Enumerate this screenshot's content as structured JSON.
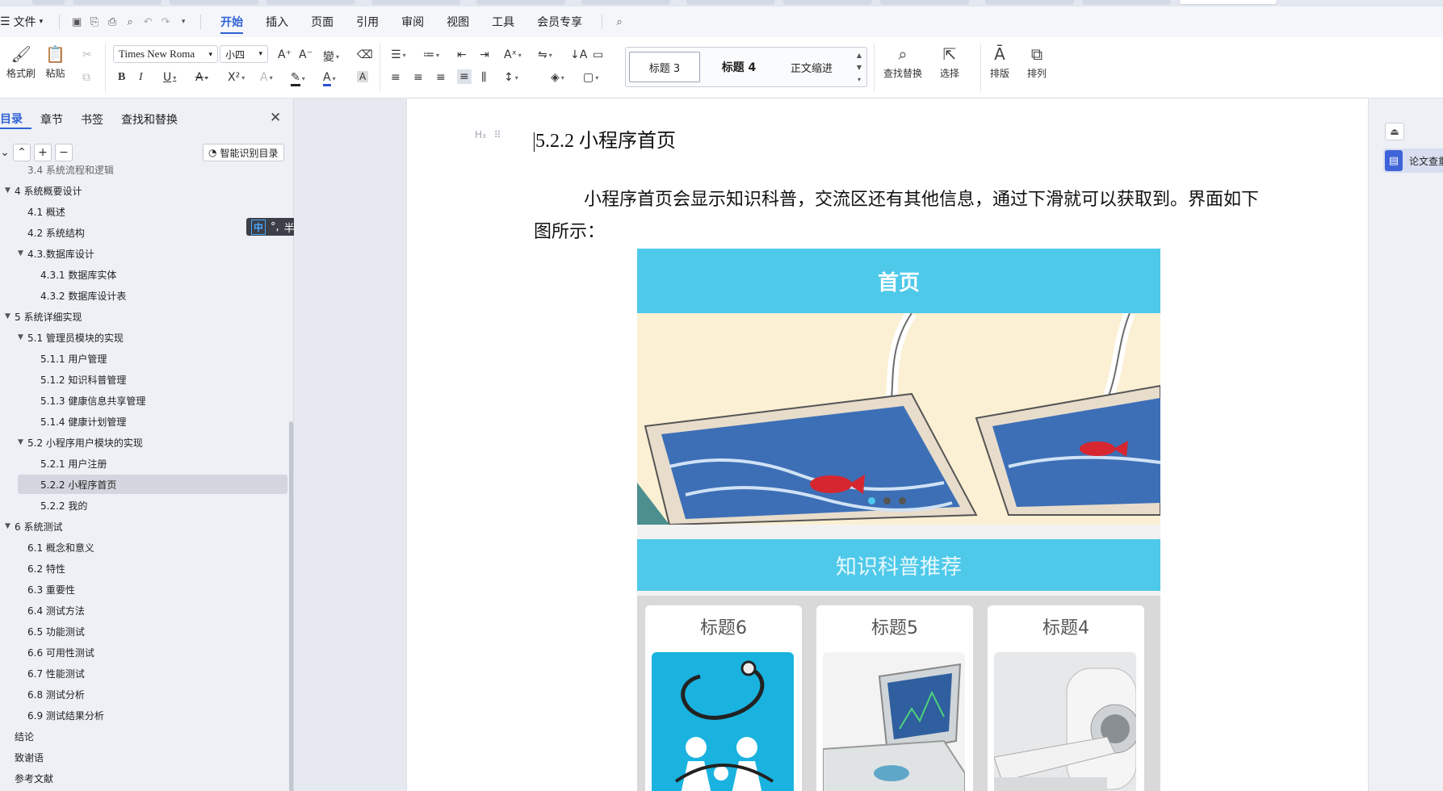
{
  "menubar": {
    "file": "文件",
    "tabs": [
      "开始",
      "插入",
      "页面",
      "引用",
      "审阅",
      "视图",
      "工具",
      "会员专享"
    ]
  },
  "ribbon": {
    "format_painter": "格式刷",
    "paste": "粘贴",
    "font_name": "Times New Roma",
    "font_size": "小四",
    "styles": [
      "标题 3",
      "标题 4",
      "正文缩进"
    ],
    "find_replace": "查找替换",
    "select": "选择",
    "layout": "排版",
    "arrange": "排列"
  },
  "navpanel": {
    "tabs": [
      "目录",
      "章节",
      "书签",
      "查找和替换"
    ],
    "smart_toc": "智能识别目录",
    "items": [
      {
        "label": "3.4 系统流程和逻辑",
        "level": 2,
        "expanded": null
      },
      {
        "label": "4 系统概要设计",
        "level": 1,
        "expanded": true
      },
      {
        "label": "4.1 概述",
        "level": 2,
        "expanded": null
      },
      {
        "label": "4.2 系统结构",
        "level": 2,
        "expanded": null
      },
      {
        "label": "4.3.数据库设计",
        "level": 2,
        "expanded": true
      },
      {
        "label": "4.3.1 数据库实体",
        "level": 3,
        "expanded": null
      },
      {
        "label": "4.3.2 数据库设计表",
        "level": 3,
        "expanded": null
      },
      {
        "label": "5 系统详细实现",
        "level": 1,
        "expanded": true
      },
      {
        "label": "5.1  管理员模块的实现",
        "level": 2,
        "expanded": true
      },
      {
        "label": "5.1.1  用户管理",
        "level": 3,
        "expanded": null
      },
      {
        "label": "5.1.2  知识科普管理",
        "level": 3,
        "expanded": null
      },
      {
        "label": "5.1.3  健康信息共享管理",
        "level": 3,
        "expanded": null
      },
      {
        "label": "5.1.4  健康计划管理",
        "level": 3,
        "expanded": null
      },
      {
        "label": "5.2  小程序用户模块的实现",
        "level": 2,
        "expanded": true
      },
      {
        "label": "5.2.1  用户注册",
        "level": 3,
        "expanded": null
      },
      {
        "label": "5.2.2  小程序首页",
        "level": 3,
        "expanded": null,
        "selected": true
      },
      {
        "label": "5.2.2  我的",
        "level": 3,
        "expanded": null
      },
      {
        "label": "6 系统测试",
        "level": 1,
        "expanded": true
      },
      {
        "label": "6.1 概念和意义",
        "level": 2,
        "expanded": null
      },
      {
        "label": "6.2 特性",
        "level": 2,
        "expanded": null
      },
      {
        "label": "6.3 重要性",
        "level": 2,
        "expanded": null
      },
      {
        "label": "6.4 测试方法",
        "level": 2,
        "expanded": null
      },
      {
        "label": "6.5  功能测试",
        "level": 2,
        "expanded": null
      },
      {
        "label": "6.6 可用性测试",
        "level": 2,
        "expanded": null
      },
      {
        "label": "6.7 性能测试",
        "level": 2,
        "expanded": null
      },
      {
        "label": "6.8 测试分析",
        "level": 2,
        "expanded": null
      },
      {
        "label": "6.9 测试结果分析",
        "level": 2,
        "expanded": null
      },
      {
        "label": "结论",
        "level": 1,
        "expanded": null
      },
      {
        "label": "致谢语",
        "level": 1,
        "expanded": null
      },
      {
        "label": "参考文献",
        "level": 1,
        "expanded": null
      }
    ]
  },
  "ime": {
    "mode": "中",
    "punct": "°,",
    "width": "半"
  },
  "document": {
    "heading_mark": "H₃",
    "heading": "5.2.2  小程序首页",
    "paragraph": "小程序首页会显示知识科普，交流区还有其他信息，通过下滑就可以获取到。界面如下图所示："
  },
  "phone": {
    "title": "首页",
    "recommend": "知识科普推荐",
    "cards": [
      "标题6",
      "标题5",
      "标题4"
    ]
  },
  "rightrail": {
    "thesis_check": "论文查重"
  },
  "colors": {
    "accent": "#2e63d6",
    "app_header": "#4ec9ea"
  }
}
